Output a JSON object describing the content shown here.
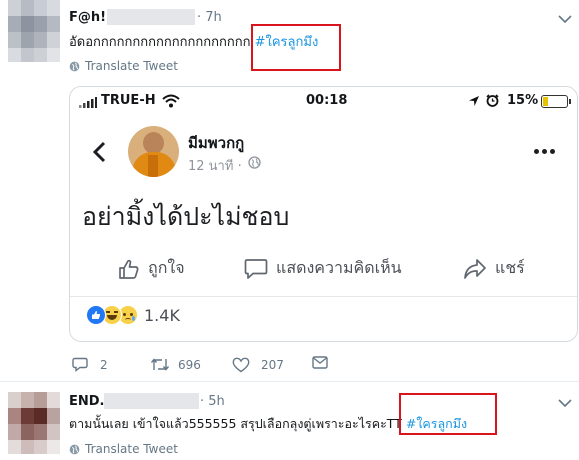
{
  "tweet1": {
    "handle": "F@h!",
    "time": "· 7h",
    "text_prefix": "อัดอกกกกกกกกกกกกกกกกกกกก ",
    "hashtag": "#ใครลูกมึง",
    "translate": "Translate Tweet",
    "actions": {
      "reply": "2",
      "retweet": "696",
      "like": "207"
    }
  },
  "embedded": {
    "status": {
      "carrier": "TRUE-H",
      "time": "00:18",
      "battery": "15%"
    },
    "poster": "มีมพวกกู",
    "posted": "12 นาที ·",
    "post_text": "อย่ามิ้งได้ปะไม่ชอบ",
    "like_label": "ถูกใจ",
    "comment_label": "แสดงความคิดเห็น",
    "share_label": "แชร์",
    "reaction_count": "1.4K"
  },
  "tweet2": {
    "handle": "END.",
    "time": "· 5h",
    "text_prefix": "ตามนั้นเลย เข้าใจแล้ว555555 สรุปเลือกลุงตู่เพราะอะไรคะTT ",
    "hashtag": "#ใครลูกมึง",
    "translate": "Translate Tweet"
  },
  "colors": {
    "hashtag": "#1b95e0",
    "highlight": "#d9141c",
    "muted": "#657786"
  }
}
